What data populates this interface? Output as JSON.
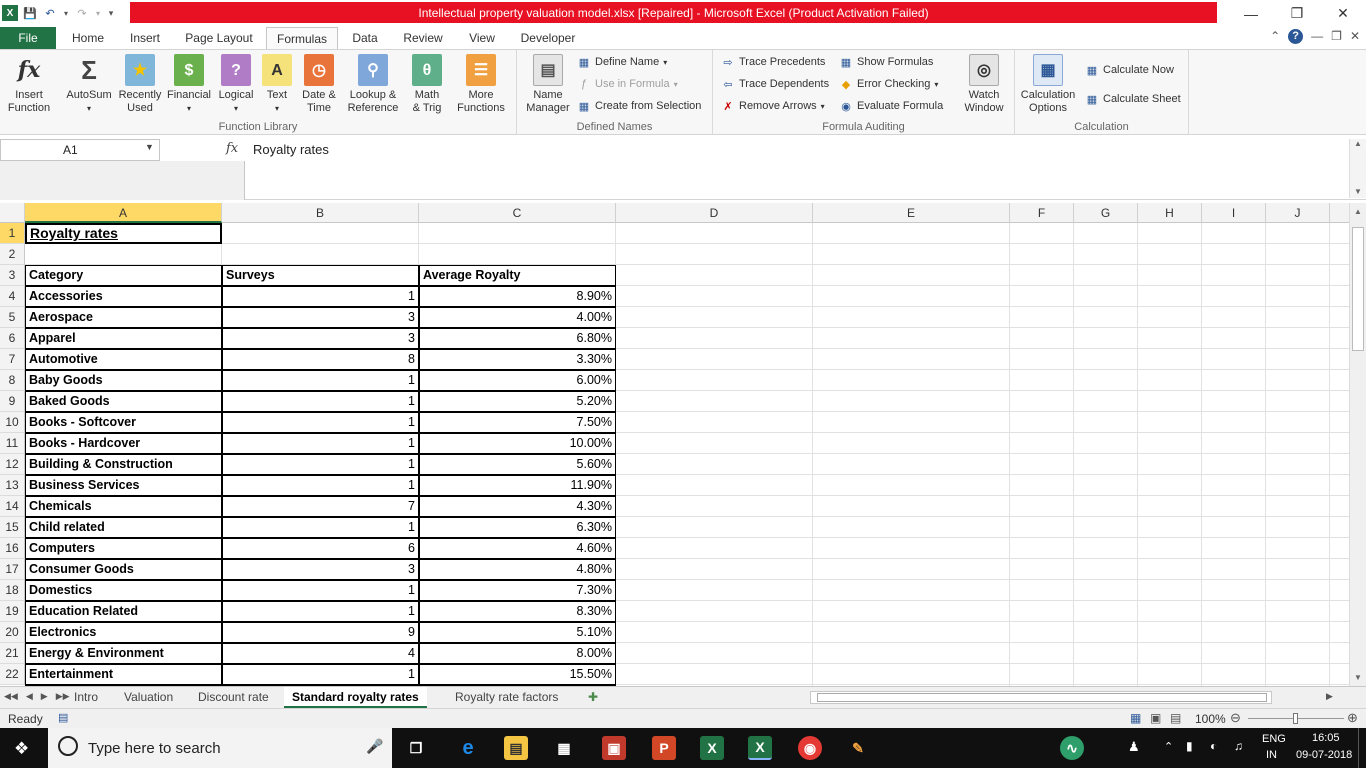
{
  "window": {
    "title": "Intellectual property valuation model.xlsx [Repaired]  -  Microsoft Excel (Product Activation Failed)",
    "minimize_icon": "minimize-icon",
    "restore_icon": "restore-icon",
    "close_icon": "close-icon"
  },
  "tabs": [
    "File",
    "Home",
    "Insert",
    "Page Layout",
    "Formulas",
    "Data",
    "Review",
    "View",
    "Developer"
  ],
  "active_tab": "Formulas",
  "ribbon": {
    "function_library": {
      "label": "Function Library",
      "insert_function": "Insert\nFunction",
      "autosum": "AutoSum",
      "recently_used": "Recently\nUsed",
      "financial": "Financial",
      "logical": "Logical",
      "text": "Text",
      "date_time": "Date &\nTime",
      "lookup": "Lookup &\nReference",
      "math": "Math\n& Trig",
      "more": "More\nFunctions"
    },
    "defined_names": {
      "label": "Defined Names",
      "name_manager": "Name\nManager",
      "define_name": "Define Name",
      "use_in_formula": "Use in Formula",
      "create_from_selection": "Create from Selection"
    },
    "formula_auditing": {
      "label": "Formula Auditing",
      "trace_precedents": "Trace Precedents",
      "trace_dependents": "Trace Dependents",
      "remove_arrows": "Remove Arrows",
      "show_formulas": "Show Formulas",
      "error_checking": "Error Checking",
      "evaluate_formula": "Evaluate Formula",
      "watch_window": "Watch\nWindow"
    },
    "calculation": {
      "label": "Calculation",
      "calculation_options": "Calculation\nOptions",
      "calculate_now": "Calculate Now",
      "calculate_sheet": "Calculate Sheet"
    }
  },
  "formula_bar": {
    "name_box": "A1",
    "fx": "fx",
    "content": "Royalty rates"
  },
  "columns": [
    "A",
    "B",
    "C",
    "D",
    "E",
    "F",
    "G",
    "H",
    "I",
    "J"
  ],
  "rows": [
    "1",
    "2",
    "3",
    "4",
    "5",
    "6",
    "7",
    "8",
    "9",
    "10",
    "11",
    "12",
    "13",
    "14",
    "15",
    "16",
    "17",
    "18",
    "19",
    "20",
    "21",
    "22"
  ],
  "sheet": {
    "title": "Royalty rates",
    "headers": [
      "Category",
      "Surveys",
      "Average Royalty"
    ],
    "data": [
      [
        "Accessories",
        "1",
        "8.90%"
      ],
      [
        "Aerospace",
        "3",
        "4.00%"
      ],
      [
        "Apparel",
        "3",
        "6.80%"
      ],
      [
        "Automotive",
        "8",
        "3.30%"
      ],
      [
        "Baby Goods",
        "1",
        "6.00%"
      ],
      [
        "Baked Goods",
        "1",
        "5.20%"
      ],
      [
        "Books - Softcover",
        "1",
        "7.50%"
      ],
      [
        "Books - Hardcover",
        "1",
        "10.00%"
      ],
      [
        "Building & Construction",
        "1",
        "5.60%"
      ],
      [
        "Business Services",
        "1",
        "11.90%"
      ],
      [
        "Chemicals",
        "7",
        "4.30%"
      ],
      [
        "Child related",
        "1",
        "6.30%"
      ],
      [
        "Computers",
        "6",
        "4.60%"
      ],
      [
        "Consumer Goods",
        "3",
        "4.80%"
      ],
      [
        "Domestics",
        "1",
        "7.30%"
      ],
      [
        "Education Related",
        "1",
        "8.30%"
      ],
      [
        "Electronics",
        "9",
        "5.10%"
      ],
      [
        "Energy & Environment",
        "4",
        "8.00%"
      ],
      [
        "Entertainment",
        "1",
        "15.50%"
      ]
    ]
  },
  "sheet_tabs": [
    "Intro",
    "Valuation",
    "Discount rate",
    "Standard royalty rates",
    "Royalty rate factors"
  ],
  "active_sheet": "Standard royalty rates",
  "status": {
    "ready": "Ready",
    "zoom": "100%"
  },
  "taskbar": {
    "search_placeholder": "Type here to search",
    "language": "ENG",
    "region": "IN",
    "time": "16:05",
    "date": "09-07-2018"
  }
}
